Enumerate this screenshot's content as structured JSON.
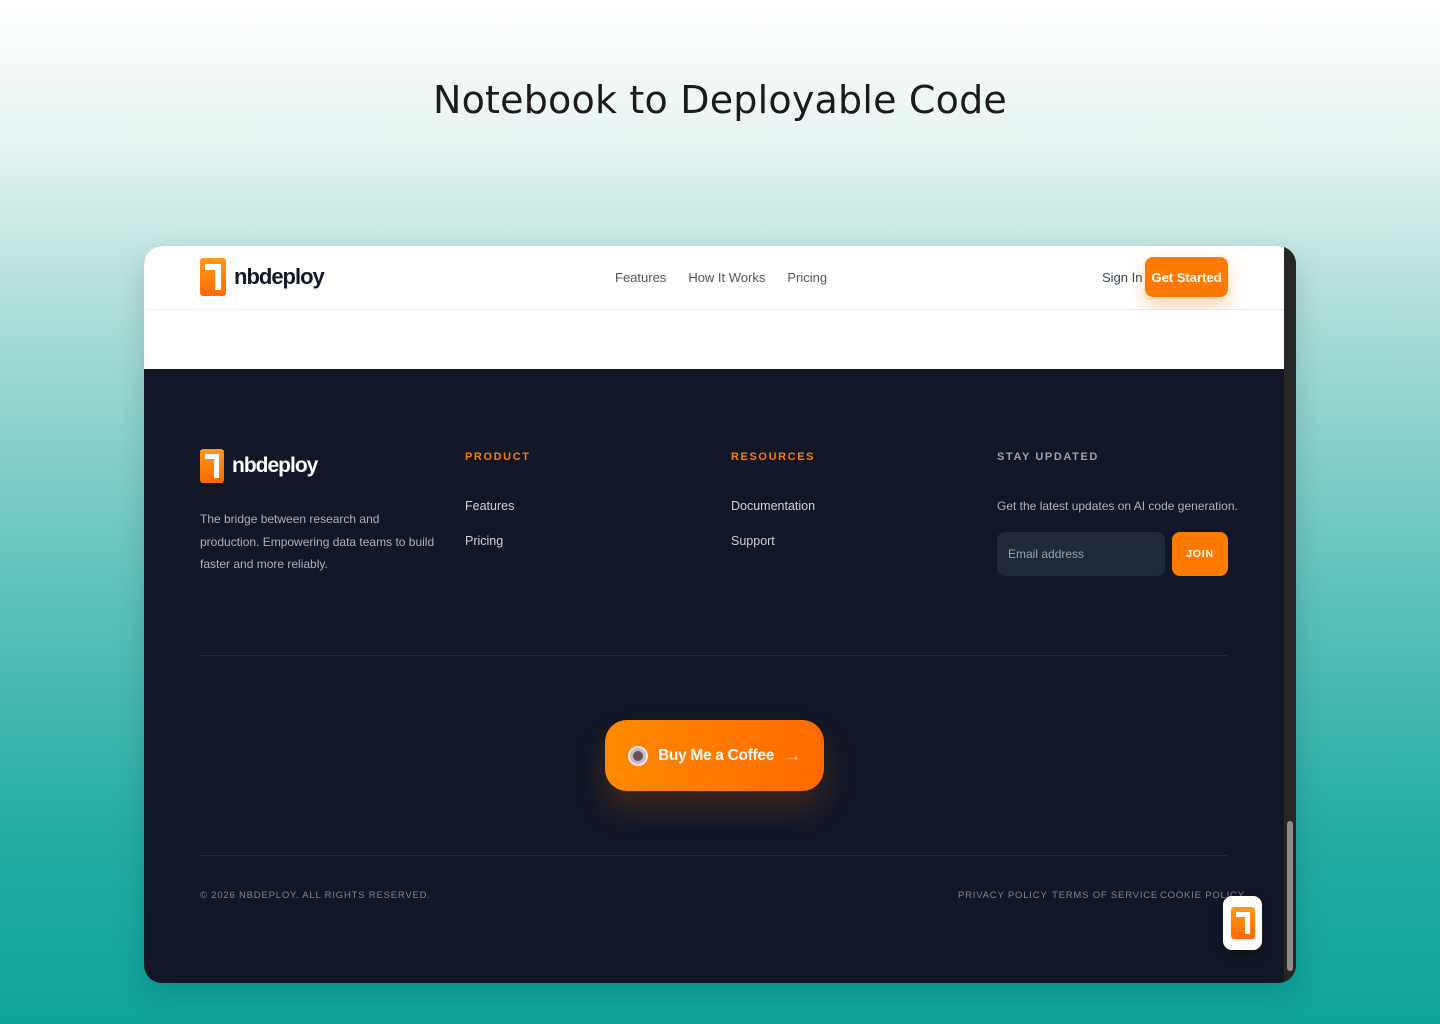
{
  "headline": "Notebook to Deployable Code",
  "nav": {
    "brand": "nbdeploy",
    "links": [
      "Features",
      "How It Works",
      "Pricing"
    ],
    "sign_in": "Sign In",
    "get_started": "Get Started"
  },
  "footer": {
    "brand": "nbdeploy",
    "tagline": "The bridge between research and production. Empowering data teams to build faster and more reliably.",
    "product": {
      "heading": "PRODUCT",
      "links": [
        "Features",
        "Pricing"
      ]
    },
    "resources": {
      "heading": "RESOURCES",
      "links": [
        "Documentation",
        "Support"
      ]
    },
    "newsletter": {
      "heading": "STAY UPDATED",
      "text": "Get the latest updates on AI code generation.",
      "placeholder": "Email address",
      "join": "JOIN"
    },
    "coffee": {
      "label": "Buy Me a Coffee",
      "icon": "coffee-cup-icon",
      "arrow": "→"
    },
    "copyright": "© 2026 NBDEPLOY. ALL RIGHTS RESERVED.",
    "legal": [
      "PRIVACY POLICY",
      "TERMS OF SERVICE",
      "COOKIE POLICY"
    ]
  },
  "colors": {
    "accent": "#ff7a00",
    "footer_bg": "#111726",
    "heading_orange": "#ff7a00",
    "heading_gray": "#94a3b8"
  }
}
